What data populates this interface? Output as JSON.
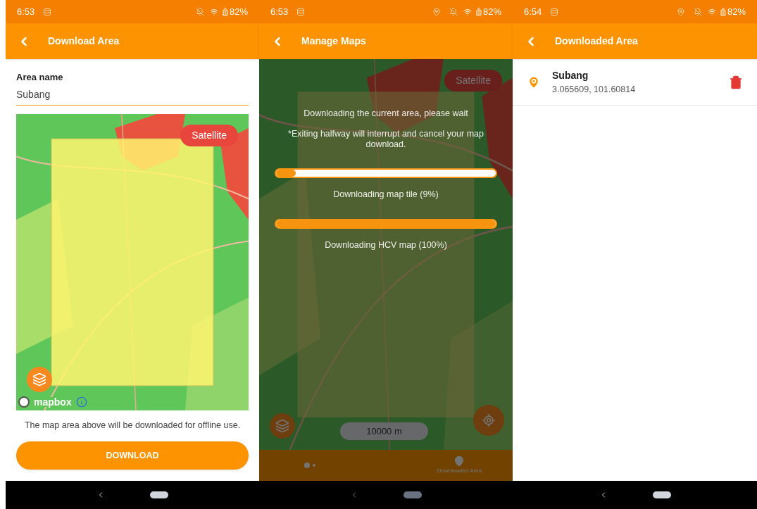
{
  "download_screen": {
    "status_bar": {
      "time": "6:53",
      "battery": "82%",
      "location_on": false
    },
    "app_bar": {
      "title": "Download Area"
    },
    "area_name": {
      "label": "Area name",
      "value": "Subang"
    },
    "map": {
      "satellite_button": "Satellite",
      "attribution": "mapbox"
    },
    "note": "The map area above will be downloaded for offline use.",
    "download_button": "DOWNLOAD"
  },
  "manage_screen": {
    "status_bar": {
      "time": "6:53",
      "battery": "82%",
      "location_on": true
    },
    "app_bar": {
      "title": "Manage Maps"
    },
    "map": {
      "satellite_button": "Satellite",
      "scale": "10000 m"
    },
    "progress": {
      "title": "Downloading the current area, please wait",
      "warning": "*Exiting halfway will interrupt and cancel your map download.",
      "bars": [
        {
          "level": 0.09,
          "reading": "Downloading map tile (9%)"
        },
        {
          "level": 1,
          "reading": "Downloading HCV map (100%)"
        }
      ]
    },
    "bottom_bar": {
      "tab": "Downloaded Area"
    }
  },
  "downloaded_screen": {
    "status_bar": {
      "time": "6:54",
      "battery": "82%",
      "location_on": true
    },
    "app_bar": {
      "title": "Downloaded Area"
    },
    "areas": [
      {
        "name": "Subang",
        "coordinates": "3.065609, 101.60814"
      }
    ]
  }
}
